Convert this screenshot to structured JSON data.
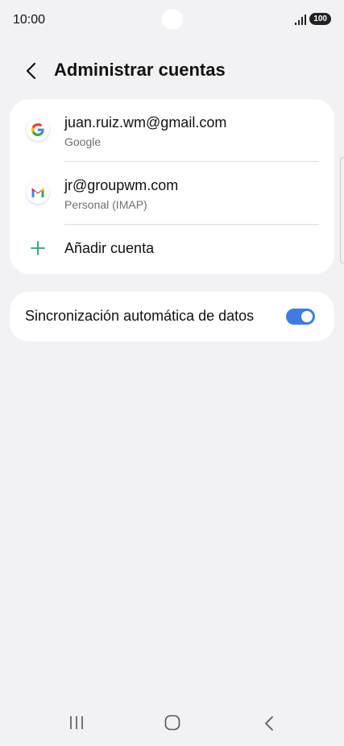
{
  "status": {
    "time": "10:00",
    "battery": "100"
  },
  "header": {
    "title": "Administrar cuentas"
  },
  "accounts": [
    {
      "email": "juan.ruiz.wm@gmail.com",
      "type": "Google",
      "icon": "google-icon"
    },
    {
      "email": "jr@groupwm.com",
      "type": "Personal (IMAP)",
      "icon": "gmail-icon"
    }
  ],
  "add_account": {
    "label": "Añadir cuenta"
  },
  "sync": {
    "label": "Sincronización automática de datos",
    "enabled": true
  },
  "colors": {
    "background": "#f2f2f4",
    "card": "#ffffff",
    "accent": "#3e7ddf",
    "add_icon": "#2e9e78"
  }
}
